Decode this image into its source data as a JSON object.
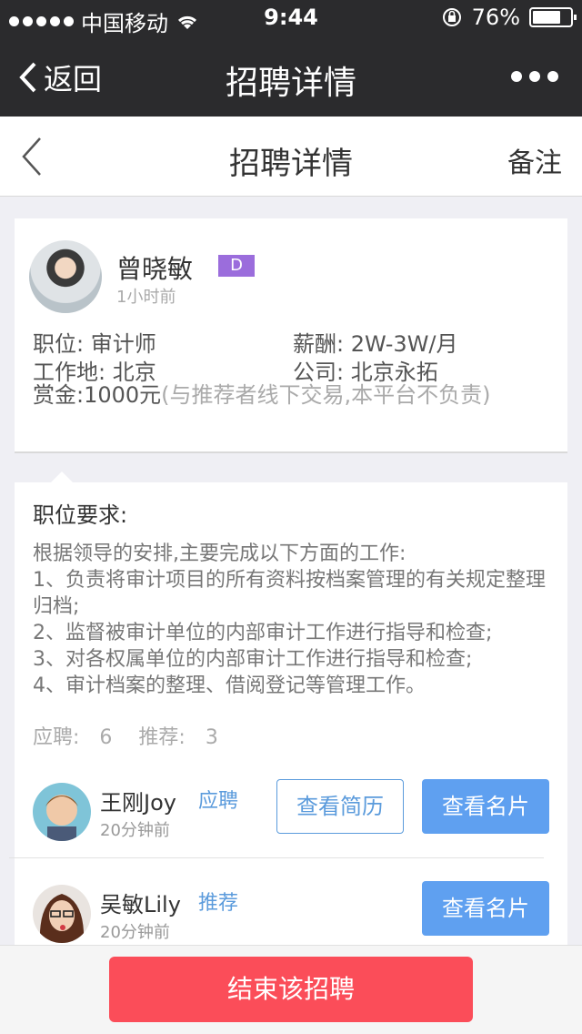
{
  "status_bar": {
    "carrier": "中国移动",
    "time": "9:44",
    "battery": "76%",
    "battery_level": 0.76
  },
  "top_nav": {
    "back_label": "返回",
    "title": "招聘详情"
  },
  "header": {
    "title": "招聘详情",
    "note_label": "备注"
  },
  "poster": {
    "name": "曾晓敏",
    "badge": "D",
    "time": "1小时前",
    "position_label": "职位:",
    "position_value": "审计师",
    "salary_label": "薪酬:",
    "salary_value": "2W-3W/月",
    "location_label": "工作地:",
    "location_value": "北京",
    "company_label": "公司:",
    "company_value": "北京永拓",
    "reward_label": "赏金:",
    "reward_value": "1000元",
    "reward_note": "(与推荐者线下交易,本平台不负责)"
  },
  "requirements": {
    "title": "职位要求:",
    "lines": [
      "根据领导的安排,主要完成以下方面的工作:",
      "1、负责将审计项目的所有资料按档案管理的有关规定整理归档;",
      "2、监督被审计单位的内部审计工作进行指导和检查;",
      "3、对各权属单位的内部审计工作进行指导和检查;",
      "4、审计档案的整理、借阅登记等管理工作。"
    ],
    "applied_label": "应聘:",
    "applied_count": "6",
    "recommended_label": "推荐:",
    "recommended_count": "3"
  },
  "candidates": [
    {
      "name": "王刚Joy",
      "type": "应聘",
      "time": "20分钟前",
      "resume_button": "查看简历",
      "card_button": "查看名片"
    },
    {
      "name": "吴敏Lily",
      "type": "推荐",
      "time": "20分钟前",
      "card_button": "查看名片"
    }
  ],
  "footer": {
    "end_button": "结束该招聘"
  },
  "colors": {
    "nav_bg": "#2b2b2d",
    "accent_blue": "#5fa0f0",
    "badge_purple": "#9b6ddc",
    "end_red": "#fb4d59"
  }
}
